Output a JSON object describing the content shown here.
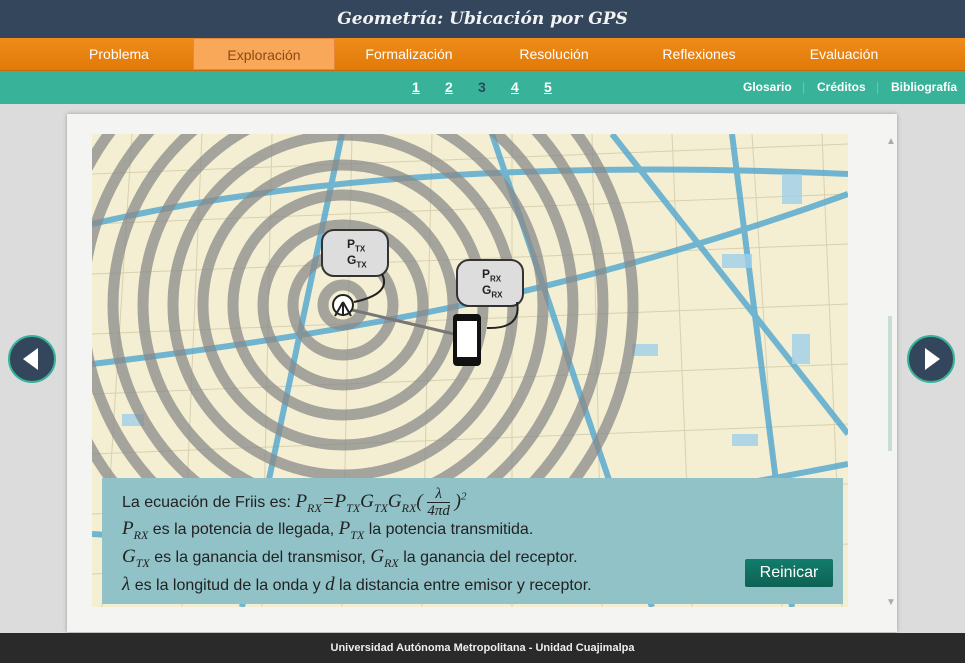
{
  "header": {
    "title": "Geometría: Ubicación por GPS"
  },
  "nav": {
    "items": [
      "Problema",
      "Exploración",
      "Formalización",
      "Resolución",
      "Reflexiones",
      "Evaluación"
    ],
    "active": 1
  },
  "subnav": {
    "pages": [
      "1",
      "2",
      "3",
      "4",
      "5"
    ],
    "current": "3",
    "links": [
      "Glosario",
      "Créditos",
      "Bibliografía"
    ]
  },
  "diagram": {
    "tx_label_p": "P",
    "tx_label_g": "G",
    "tx_sub": "TX",
    "rx_label_p": "P",
    "rx_label_g": "G",
    "rx_sub": "RX"
  },
  "info": {
    "intro": "La ecuación de Friis es:",
    "formula_lhs": "P",
    "formula_lhs_sub": "RX",
    "formula_rhs_p": "P",
    "formula_rhs_p_sub": "TX",
    "formula_rhs_g1": "G",
    "formula_rhs_g1_sub": "TX",
    "formula_rhs_g2": "G",
    "formula_rhs_g2_sub": "RX",
    "formula_num": "λ",
    "formula_den": "4πd",
    "formula_exp": "2",
    "line2_text": "es la potencia de llegada,",
    "line2_text2": "la potencia transmitida.",
    "line3_text": "es la ganancia del transmisor,",
    "line3_text2": "la ganancia del receptor.",
    "line4_sym": "λ",
    "line4_text": "es la longitud de la onda y",
    "line4_sym2": "d",
    "line4_text2": "la distancia entre emisor y receptor."
  },
  "buttons": {
    "reset": "Reinicar"
  },
  "footer": {
    "text": "Universidad Autónoma Metropolitana - Unidad Cuajimalpa"
  },
  "colors": {
    "header": "#33465c",
    "nav": "#f08c1a",
    "subnav": "#38b39a",
    "info": "#91c2c7",
    "button": "#137c6c"
  }
}
